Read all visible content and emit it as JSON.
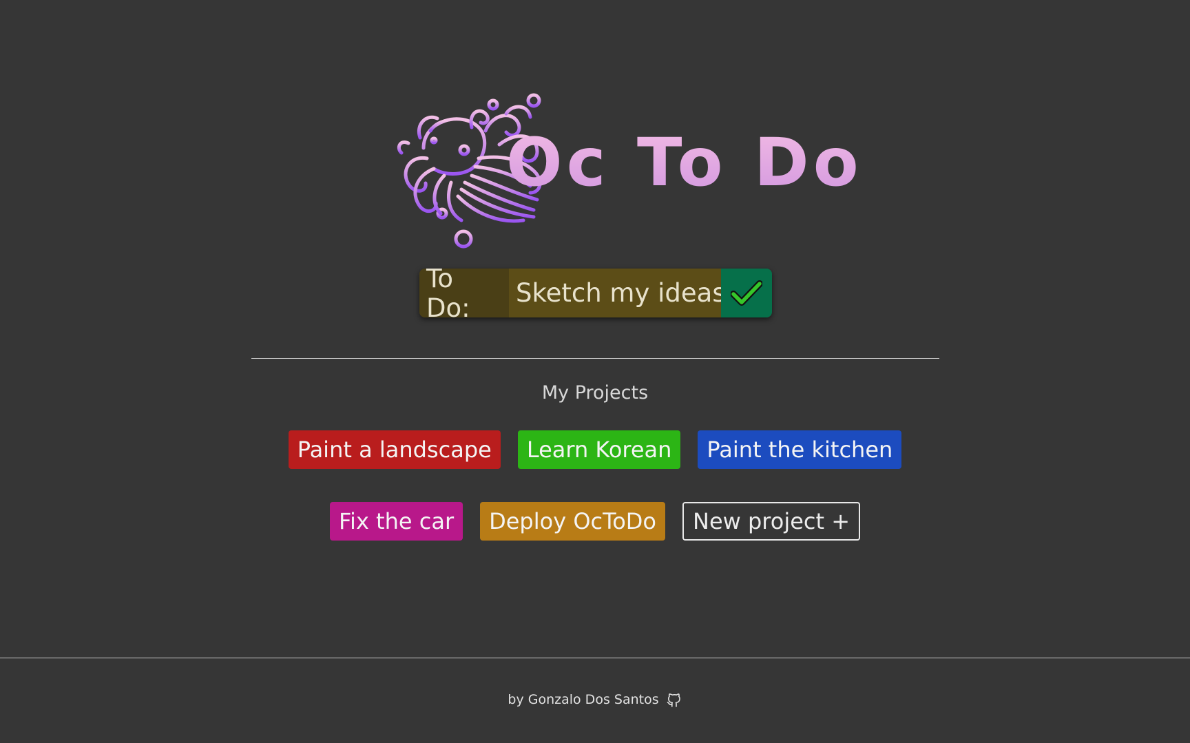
{
  "app": {
    "title": "Oc To Do"
  },
  "current_task": {
    "label": "To Do:",
    "task": "Sketch my ideas",
    "done_icon": "checkmark-icon"
  },
  "projects": {
    "title": "My Projects",
    "items": [
      {
        "label": "Paint a landscape",
        "color": "#b91d1d"
      },
      {
        "label": "Learn Korean",
        "color": "#2cb515"
      },
      {
        "label": "Paint the kitchen",
        "color": "#1c4cbf"
      },
      {
        "label": "Fix the car",
        "color": "#b8188a"
      },
      {
        "label": "Deploy OcToDo",
        "color": "#b87c16"
      }
    ],
    "new_label": "New project +"
  },
  "footer": {
    "credit": "by Gonzalo Dos Santos",
    "icon": "github-icon"
  },
  "colors": {
    "background": "#363636",
    "logo_gradient_top": "#f0b8e4",
    "logo_gradient_bottom": "#a35ef0",
    "todo_label_bg": "#4a3f16",
    "todo_task_bg": "#5c4d17",
    "todo_done_bg": "#06704a"
  }
}
